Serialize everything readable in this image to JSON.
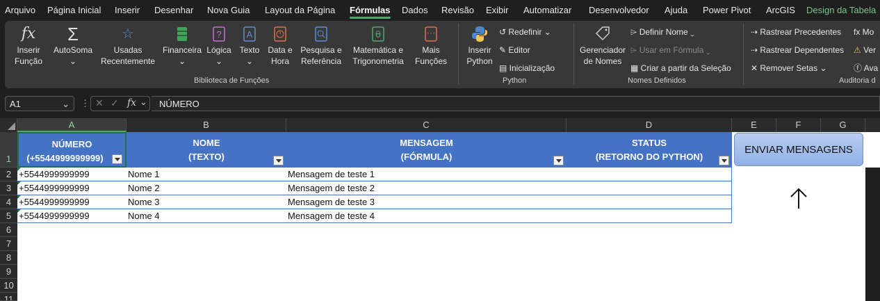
{
  "menu": [
    "Arquivo",
    "Página Inicial",
    "Inserir",
    "Desenhar",
    "Nova Guia",
    "Layout da Página",
    "Fórmulas",
    "Dados",
    "Revisão",
    "Exibir",
    "Automatizar",
    "Desenvolvedor",
    "Ajuda",
    "Power Pivot",
    "ArcGIS",
    "Design da Tabela"
  ],
  "ribbon": {
    "insert_function": "Inserir Função",
    "autosum": "AutoSoma",
    "recent": "Usadas Recentemente",
    "financial": "Financeira",
    "logical": "Lógica",
    "text": "Texto",
    "datetime": "Data e Hora",
    "lookup": "Pesquisa e Referência",
    "math": "Matemática e Trigonometria",
    "more": "Mais Funções",
    "group_library": "Biblioteca de Funções",
    "insert_python": "Inserir Python",
    "reset": "Redefinir",
    "editor": "Editor",
    "init": "Inicialização",
    "group_python": "Python",
    "name_manager": "Gerenciador de Nomes",
    "define_name": "Definir Nome",
    "use_in_formula": "Usar em Fórmula",
    "create_from_sel": "Criar a partir da Seleção",
    "group_names": "Nomes Definidos",
    "trace_prec": "Rastrear Precedentes",
    "trace_dep": "Rastrear Dependentes",
    "remove_arrows": "Remover Setas",
    "mo": "Mo",
    "ver": "Ver",
    "ava": "Ava",
    "group_audit": "Auditoria d"
  },
  "formula_bar": {
    "name_box": "A1",
    "formula": "NÚMERO"
  },
  "columns": [
    "A",
    "B",
    "C",
    "D",
    "E",
    "F",
    "G"
  ],
  "rows": [
    "1",
    "2",
    "3",
    "4",
    "5",
    "6",
    "7",
    "8",
    "9",
    "10",
    "11"
  ],
  "table": {
    "headers": [
      {
        "line1": "NÚMERO",
        "line2": "(+5544999999999)"
      },
      {
        "line1": "NOME",
        "line2": "(TEXTO)"
      },
      {
        "line1": "MENSAGEM",
        "line2": "(FÓRMULA)"
      },
      {
        "line1": "STATUS",
        "line2": "(RETORNO DO PYTHON)"
      }
    ],
    "rows": [
      [
        "+5544999999999",
        "Nome 1",
        "Mensagem de teste 1",
        ""
      ],
      [
        "+5544999999999",
        "Nome 2",
        "Mensagem de teste 2",
        ""
      ],
      [
        "+5544999999999",
        "Nome 3",
        "Mensagem de teste 3",
        ""
      ],
      [
        "+5544999999999",
        "Nome 4",
        "Mensagem de teste 4",
        ""
      ]
    ]
  },
  "send_button": "ENVIAR MENSAGENS",
  "colors": {
    "table_header": "#4472c4",
    "accent": "#4fa76b",
    "button": "#a8c0ec"
  }
}
